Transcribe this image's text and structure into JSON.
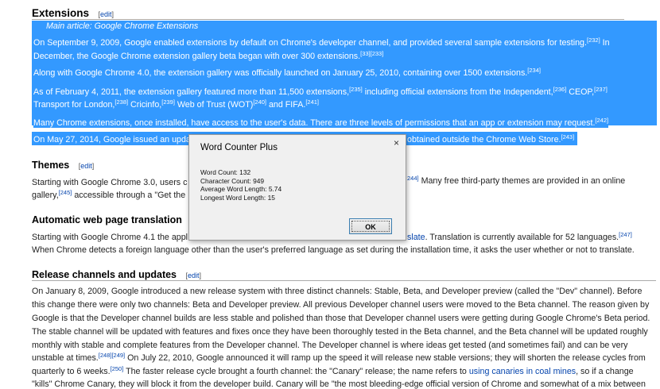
{
  "extensions": {
    "heading": "Extensions",
    "edit": "edit",
    "main_article": "Main article: Google Chrome Extensions",
    "p1a": "On September 9, 2009, Google enabled extensions by default on Chrome's developer channel, and provided several sample extensions for testing.",
    "p1_ref1": "[232]",
    "p1_tail": " In",
    "p1b": "December, the Google Chrome extension gallery beta began with over 300 extensions.",
    "p1_ref2": "[33][233]",
    "p2": "Along with Google Chrome 4.0, the extension gallery was officially launched on January 25, 2010, containing over 1500 extensions.",
    "p2_ref": "[234]",
    "p3a": "As of February 4, 2011, the extension gallery featured more than 11,500 extensions,",
    "p3_ref1": "[235]",
    "p3a2": " including official extensions from the Independent,",
    "p3_ref2": "[236]",
    "p3a3": " CEOP,",
    "p3_ref3": "[237]",
    "p3b1": "Transport for London,",
    "p3_ref4": "[238]",
    "p3b2": " Cricinfo,",
    "p3_ref5": "[239]",
    "p3b3": " Web of Trust (WOT)",
    "p3_ref6": "[240]",
    "p3b4": " and FIFA.",
    "p3_ref7": "[241]",
    "p4": "Many Chrome extensions, once installed, have access to the user's data. There are three levels of permissions that an app or extension may request.",
    "p4_ref": "[242]",
    "p5a": "On May 27, 2014, Google issued an upda",
    "p5b": "obtained outside the Chrome Web Store.",
    "p5_ref": "[243]"
  },
  "themes": {
    "heading": "Themes",
    "edit": "edit",
    "l1a": "Starting with Google Chrome 3.0, users c",
    "l1_ref": "244]",
    "l1b": " Many free third-party themes are provided in an online",
    "l2a": "gallery,",
    "l2_ref": "[245]",
    "l2b": " accessible through a \"Get the"
  },
  "translation": {
    "heading": "Automatic web page translation",
    "edit_fragment": "[",
    "l1a": "Starting with Google Chrome 4.1 the appl",
    "l1_link": "slate",
    "l1b": ". Translation is currently available for 52 languages.",
    "l1_ref": "[247]",
    "l2": "When Chrome detects a foreign language other than the user's preferred language as set during the installation time, it asks the user whether or not to translate."
  },
  "release": {
    "heading": "Release channels and updates",
    "edit": "edit",
    "l1": "On January 8, 2009, Google introduced a new release system with three distinct channels: Stable, Beta, and Developer preview (called the \"Dev\" channel). Before",
    "l2": "this change there were only two channels: Beta and Developer preview. All previous Developer channel users were moved to the Beta channel. The reason given by",
    "l3": "Google is that the Developer channel builds are less stable and polished than those that Developer channel users were getting during Google Chrome's Beta period.",
    "l4": "The stable channel will be updated with features and fixes once they have been thoroughly tested in the Beta channel, and the Beta channel will be updated roughly",
    "l5": "monthly with stable and complete features from the Developer channel. The Developer channel is where ideas get tested (and sometimes fail) and can be very",
    "l6a": "unstable at times.",
    "l6_ref": "[248][249]",
    "l6b": " On July 22, 2010, Google announced it will ramp up the speed it will release new stable versions; they will shorten the release cycles from",
    "l7a": "quarterly to 6 weeks.",
    "l7_ref": "[250]",
    "l7b": " The faster release cycle brought a fourth channel: the \"Canary\" release; the name refers to ",
    "l7_link": "using canaries in coal mines",
    "l7c": ", so if a change",
    "l8": "\"kills\" Chrome Canary, they will block it from the developer build. Canary will be \"the most bleeding-edge official version of Chrome and somewhat of a mix between"
  },
  "dialog": {
    "title": "Word Counter Plus",
    "close": "×",
    "word_count": "Word Count: 132",
    "char_count": "Character Count: 949",
    "avg_len": "Average Word Length: 5.74",
    "longest": "Longest Word Length: 15",
    "ok": "OK"
  }
}
